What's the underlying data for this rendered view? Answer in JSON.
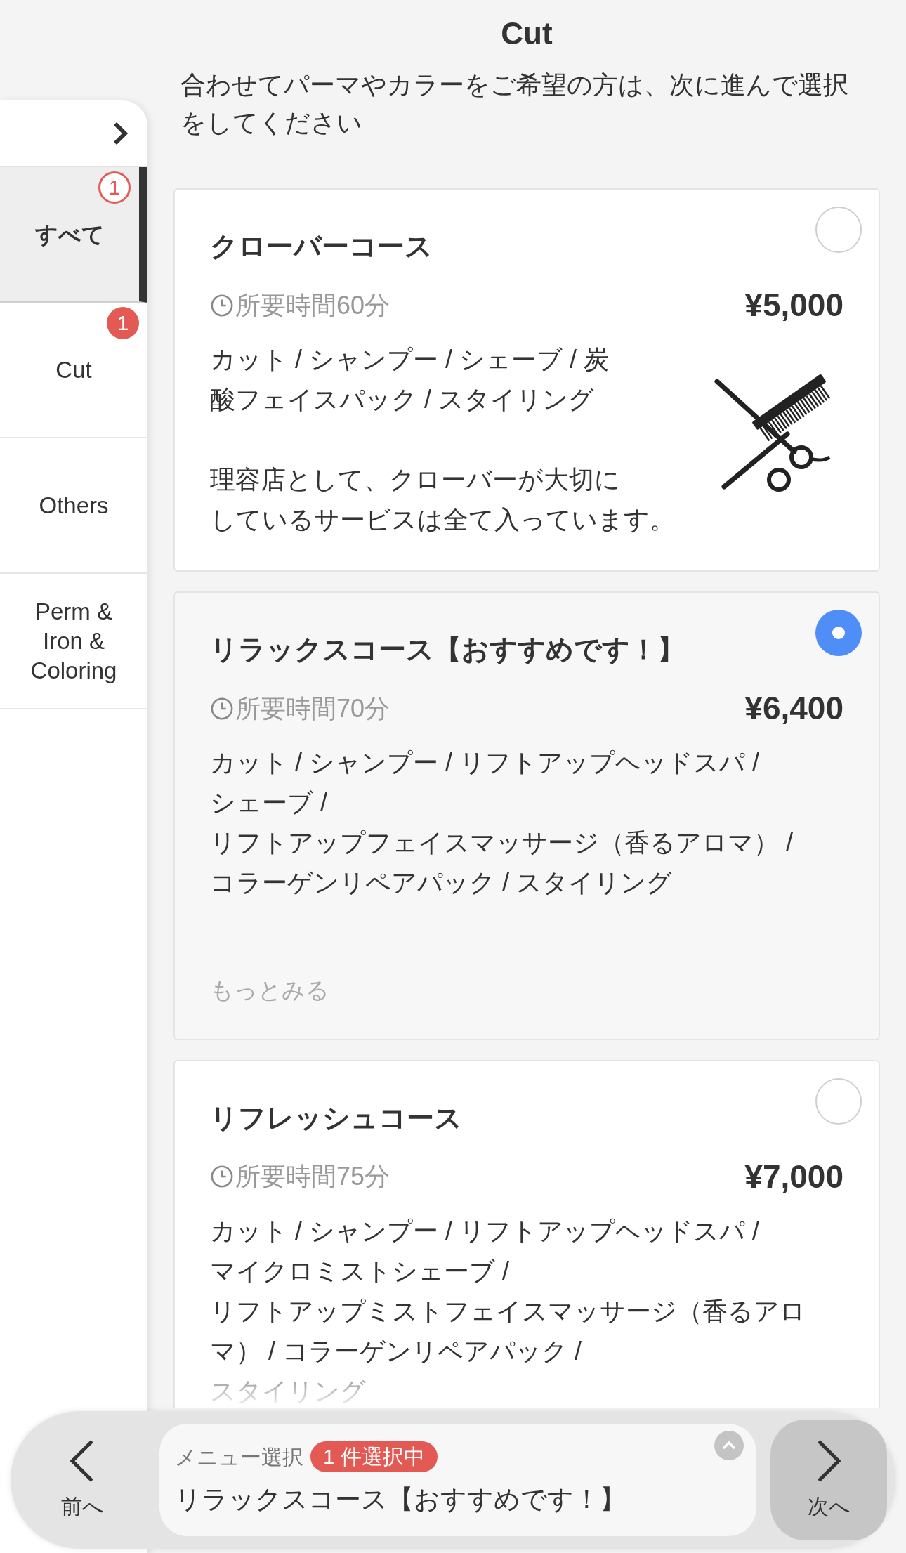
{
  "header": {
    "title": "Cut",
    "subtitle": "合わせてパーマやカラーをご希望の方は、次に進んで選択をしてください"
  },
  "sidebar": {
    "items": [
      {
        "label": "すべて",
        "selected": true,
        "badge": {
          "count": "1",
          "kind": "outline"
        }
      },
      {
        "label": "Cut",
        "selected": false,
        "badge": {
          "count": "1",
          "kind": "filled"
        }
      },
      {
        "label": "Others",
        "selected": false
      },
      {
        "label": "Perm & Iron & Coloring",
        "selected": false
      }
    ]
  },
  "courses": [
    {
      "title": "クローバーコース",
      "duration": "所要時間60分",
      "price": "¥5,000",
      "selected": false,
      "image": true,
      "description": [
        "カット / シャンプー / シェーブ / 炭",
        "酸フェイスパック / スタイリング"
      ],
      "note": [
        "理容店として、クローバーが大切に",
        "しているサービスは全て入っています。"
      ]
    },
    {
      "title": "リラックスコース【おすすめです！】",
      "duration": "所要時間70分",
      "price": "¥6,400",
      "selected": true,
      "description": [
        "カット / シャンプー / リフトアップヘッドスパ /",
        "シェーブ /",
        "リフトアップフェイスマッサージ（香るアロマ） /",
        "コラーゲンリペアパック / スタイリング"
      ],
      "more_link": "もっとみる"
    },
    {
      "title": "リフレッシュコース",
      "duration": "所要時間75分",
      "price": "¥7,000",
      "selected": false,
      "fade_last": true,
      "description": [
        "カット / シャンプー / リフトアップヘッドスパ /",
        "マイクロミストシェーブ /",
        "リフトアップミストフェイスマッサージ（香るアロ",
        "マ） / コラーゲンリペアパック /",
        "スタイリング"
      ]
    }
  ],
  "bottom_bar": {
    "prev_label": "前へ",
    "next_label": "次へ",
    "selection_label": "メニュー選択",
    "selection_count": "1 件選択中",
    "selected_name": "リラックスコース【おすすめです！】"
  }
}
